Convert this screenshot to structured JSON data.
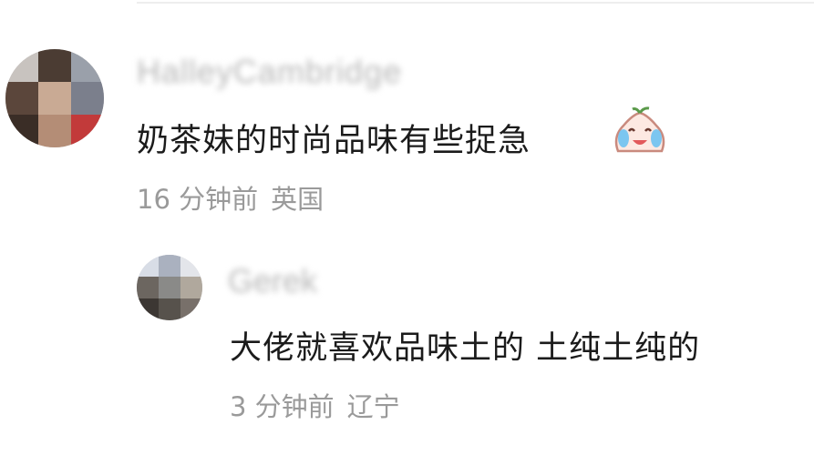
{
  "comments": [
    {
      "username": "HalleyCambridge",
      "text": "奶茶妹的时尚品味有些捉急",
      "emoji": "crying-laughing-bun-emoji",
      "time": "16 分钟前",
      "location": "英国"
    }
  ],
  "replies": [
    {
      "username": "Gerek",
      "text": "大佬就喜欢品味土的 土纯土纯的",
      "time": "3 分钟前",
      "location": "辽宁"
    }
  ]
}
